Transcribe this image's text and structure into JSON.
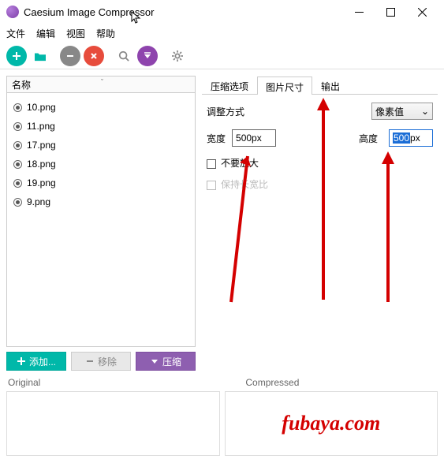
{
  "window": {
    "title": "Caesium Image Compressor"
  },
  "menu": {
    "file": "文件",
    "edit": "编辑",
    "view": "视图",
    "help": "帮助"
  },
  "list": {
    "header": "名称",
    "items": [
      {
        "name": "10.png"
      },
      {
        "name": "11.png"
      },
      {
        "name": "17.png"
      },
      {
        "name": "18.png"
      },
      {
        "name": "19.png"
      },
      {
        "name": "9.png"
      }
    ]
  },
  "buttons": {
    "add": "添加...",
    "remove": "移除",
    "compress": "压缩"
  },
  "tabs": {
    "compress": "压缩选项",
    "size": "图片尺寸",
    "output": "输出"
  },
  "size_panel": {
    "mode_label": "调整方式",
    "mode_value": "像素值",
    "width_label": "宽度",
    "width_value": "500px",
    "height_label": "高度",
    "height_value_sel": "500",
    "height_value_unit": "px",
    "no_enlarge": "不要放大",
    "keep_ratio": "保持长宽比"
  },
  "preview": {
    "original": "Original",
    "compressed": "Compressed"
  },
  "watermark": "fubaya.com"
}
